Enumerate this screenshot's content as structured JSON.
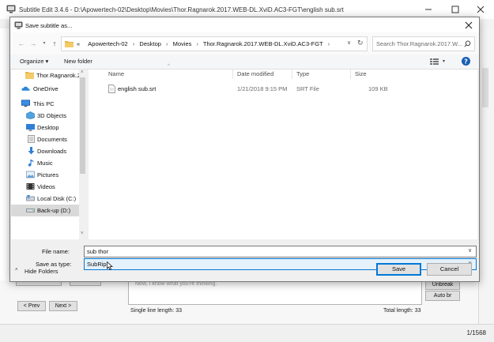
{
  "app": {
    "title": "Subtitle Edit 3.4.6 - D:\\Apowertech-02\\Desktop\\Movies\\Thor.Ragnarok.2017.WEB-DL.XviD.AC3-FGT\\english sub.srt",
    "prev_button": "< Prev",
    "next_button": "Next >",
    "unbreak_button": "Unbreak",
    "autobr_button": "Auto br",
    "single_line_length": "Single line length: 33",
    "total_length": "Total length: 33",
    "editor_text_partial": "Now, I know what you're thinking.",
    "status": "1/1568"
  },
  "dialog": {
    "title": "Save subtitle as...",
    "breadcrumb": [
      "«",
      "Apowertech-02",
      "Desktop",
      "Movies",
      "Thor.Ragnarok.2017.WEB-DL.XviD.AC3-FGT"
    ],
    "search_placeholder": "Search Thor.Ragnarok.2017.W...",
    "organize": "Organize ▾",
    "new_folder": "New folder",
    "nav_items": [
      {
        "label": "Thor.Ragnarok.2",
        "icon": "folder-icon"
      },
      {
        "label": "OneDrive",
        "icon": "onedrive-icon"
      },
      {
        "label": "This PC",
        "icon": "computer-icon"
      },
      {
        "label": "3D Objects",
        "icon": "3d-objects-icon"
      },
      {
        "label": "Desktop",
        "icon": "desktop-icon"
      },
      {
        "label": "Documents",
        "icon": "documents-icon"
      },
      {
        "label": "Downloads",
        "icon": "downloads-icon"
      },
      {
        "label": "Music",
        "icon": "music-icon"
      },
      {
        "label": "Pictures",
        "icon": "pictures-icon"
      },
      {
        "label": "Videos",
        "icon": "videos-icon"
      },
      {
        "label": "Local Disk (C:)",
        "icon": "local-disk-icon"
      },
      {
        "label": "Back-up (D:)",
        "icon": "drive-icon"
      }
    ],
    "columns": {
      "name": "Name",
      "date": "Date modified",
      "type": "Type",
      "size": "Size"
    },
    "files": [
      {
        "name": "english sub.srt",
        "date": "1/21/2018 9:15 PM",
        "type": "SRT File",
        "size": "109 KB"
      }
    ],
    "file_name_label": "File name:",
    "file_name_value": "sub thor",
    "save_type_label": "Save as type:",
    "save_type_value": "SubRip",
    "hide_folders": "Hide Folders",
    "save_button": "Save",
    "cancel_button": "Cancel"
  },
  "colors": {
    "accent": "#0078d7",
    "folder": "#e8b64a",
    "selected_nav": "#d9d9d9"
  }
}
